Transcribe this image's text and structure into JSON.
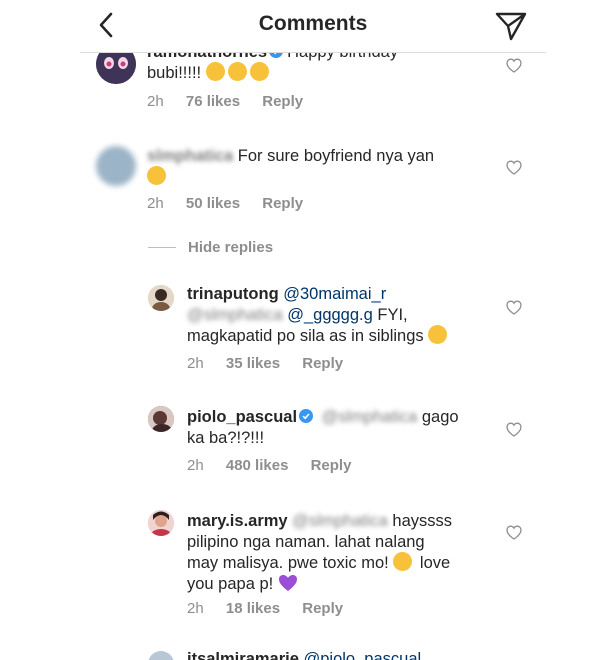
{
  "header": {
    "title": "Comments"
  },
  "comments": [
    {
      "username": "ramonathornes",
      "text": "Happy birthday",
      "text2": "bubi!!!!!",
      "time": "2h",
      "likes": "76 likes",
      "reply": "Reply"
    },
    {
      "username": "slmphatica",
      "text": "For sure boyfriend nya yan",
      "time": "2h",
      "likes": "50 likes",
      "reply": "Reply"
    }
  ],
  "hide_replies": "Hide replies",
  "replies": [
    {
      "username": "trinaputong",
      "mention1": "@30maimai_r",
      "mention_blur": "@slmphatica",
      "mention2": "@_ggggg.g",
      "text_a": "FYI,",
      "text_b": "magkapatid po sila as in siblings",
      "time": "2h",
      "likes": "35 likes",
      "reply": "Reply"
    },
    {
      "username": "piolo_pascual",
      "mention_blur": "@slmphatica",
      "text_a": "gago",
      "text_b": "ka ba?!?!!!",
      "time": "2h",
      "likes": "480 likes",
      "reply": "Reply"
    },
    {
      "username": "mary.is.army",
      "mention_blur": "@slmphatica",
      "text_a": "hayssss",
      "text_b": "pilipino nga naman. lahat nalang",
      "text_c": "may malisya. pwe toxic mo!",
      "text_d": "love",
      "text_e": "you papa p!",
      "time": "2h",
      "likes": "18 likes",
      "reply": "Reply"
    },
    {
      "username": "itsalmiramarie",
      "mention1": "@piolo_pascual"
    }
  ]
}
